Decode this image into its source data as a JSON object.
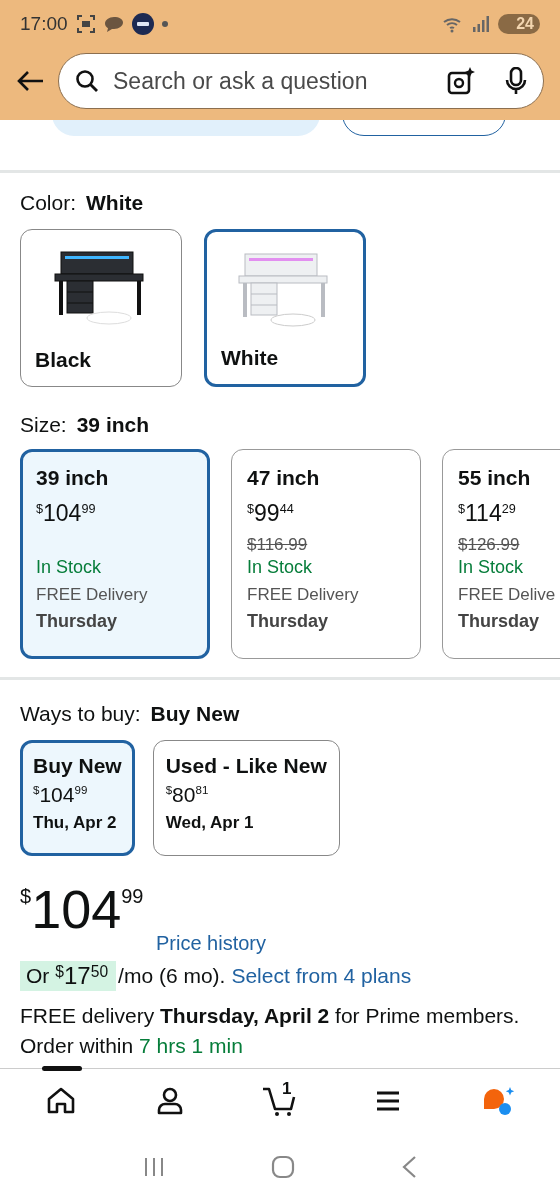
{
  "status_bar": {
    "time": "17:00",
    "battery": "24"
  },
  "header": {
    "search": {
      "placeholder": "Search or ask a question"
    }
  },
  "color": {
    "label": "Color:",
    "value": "White",
    "options": [
      {
        "name": "Black",
        "selected": false,
        "kind": "picture"
      },
      {
        "name": "White",
        "selected": true,
        "kind": "picture"
      }
    ]
  },
  "size": {
    "label": "Size:",
    "value": "39 inch",
    "options": [
      {
        "name": "39 inch",
        "selected": true,
        "price": {
          "symbol": "$",
          "whole": "104",
          "fraction": "99"
        },
        "stock": "In Stock",
        "delivery": "FREE Delivery",
        "day": "Thursday"
      },
      {
        "name": "47 inch",
        "selected": false,
        "price": {
          "symbol": "$",
          "whole": "99",
          "fraction": "44"
        },
        "list_price": "$116.99",
        "stock": "In Stock",
        "delivery": "FREE Delivery",
        "day": "Thursday"
      },
      {
        "name": "55 inch",
        "selected": false,
        "price": {
          "symbol": "$",
          "whole": "114",
          "fraction": "29"
        },
        "list_price": "$126.99",
        "stock": "In Stock",
        "delivery": "FREE Delive",
        "day": "Thursday"
      }
    ]
  },
  "ways_to_buy": {
    "label": "Ways to buy:",
    "value": "Buy New",
    "options": [
      {
        "name": "Buy New",
        "selected": true,
        "price": {
          "symbol": "$",
          "whole": "104",
          "fraction": "99"
        },
        "date": "Thu, Apr 2"
      },
      {
        "name": "Used - Like New",
        "selected": false,
        "price": {
          "symbol": "$",
          "whole": "80",
          "fraction": "81"
        },
        "date": "Wed, Apr 1"
      }
    ]
  },
  "price": {
    "symbol": "$",
    "whole": "104",
    "fraction": "99"
  },
  "price_history": "Price history",
  "installment": {
    "prefix": "Or",
    "symbol": "$",
    "whole": "17",
    "fraction": "50",
    "terms": "/mo (6 mo).",
    "link": "Select from 4 plans"
  },
  "delivery": {
    "text": "FREE delivery **Thursday, April 2** for Prime members. Order within",
    "countdown": "7 hrs 1 min"
  },
  "bottom_nav": [
    {
      "kind": "home",
      "selected": true
    },
    {
      "kind": "account",
      "selected": false
    },
    {
      "kind": "cart",
      "selected": false,
      "count": "1"
    },
    {
      "kind": "menu",
      "selected": false
    },
    {
      "kind": "assistant",
      "selected": false
    }
  ]
}
